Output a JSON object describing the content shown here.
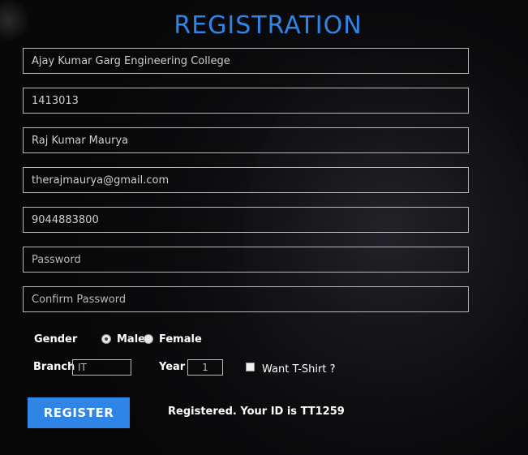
{
  "title": "REGISTRATION",
  "fields": {
    "college": {
      "value": "Ajay Kumar Garg Engineering College"
    },
    "roll": {
      "value": "1413013"
    },
    "name": {
      "value": "Raj Kumar Maurya"
    },
    "email": {
      "value": "therajmaurya@gmail.com"
    },
    "phone": {
      "value": "9044883800"
    },
    "password": {
      "placeholder": "Password"
    },
    "confirm_password": {
      "placeholder": "Confirm Password"
    }
  },
  "gender": {
    "label": "Gender",
    "options": [
      "Male",
      "Female"
    ],
    "selected": "Male"
  },
  "branch": {
    "label": "Branch",
    "placeholder": "IT"
  },
  "year": {
    "label": "Year",
    "placeholder": "1"
  },
  "tshirt": {
    "label": "Want T-Shirt ?",
    "checked": false
  },
  "register_button": "REGISTER",
  "status_message": "Registered. Your ID is TT1259",
  "colors": {
    "accent": "#2f85e6",
    "background": "#0a0a0c",
    "border": "#b9b9b9"
  }
}
